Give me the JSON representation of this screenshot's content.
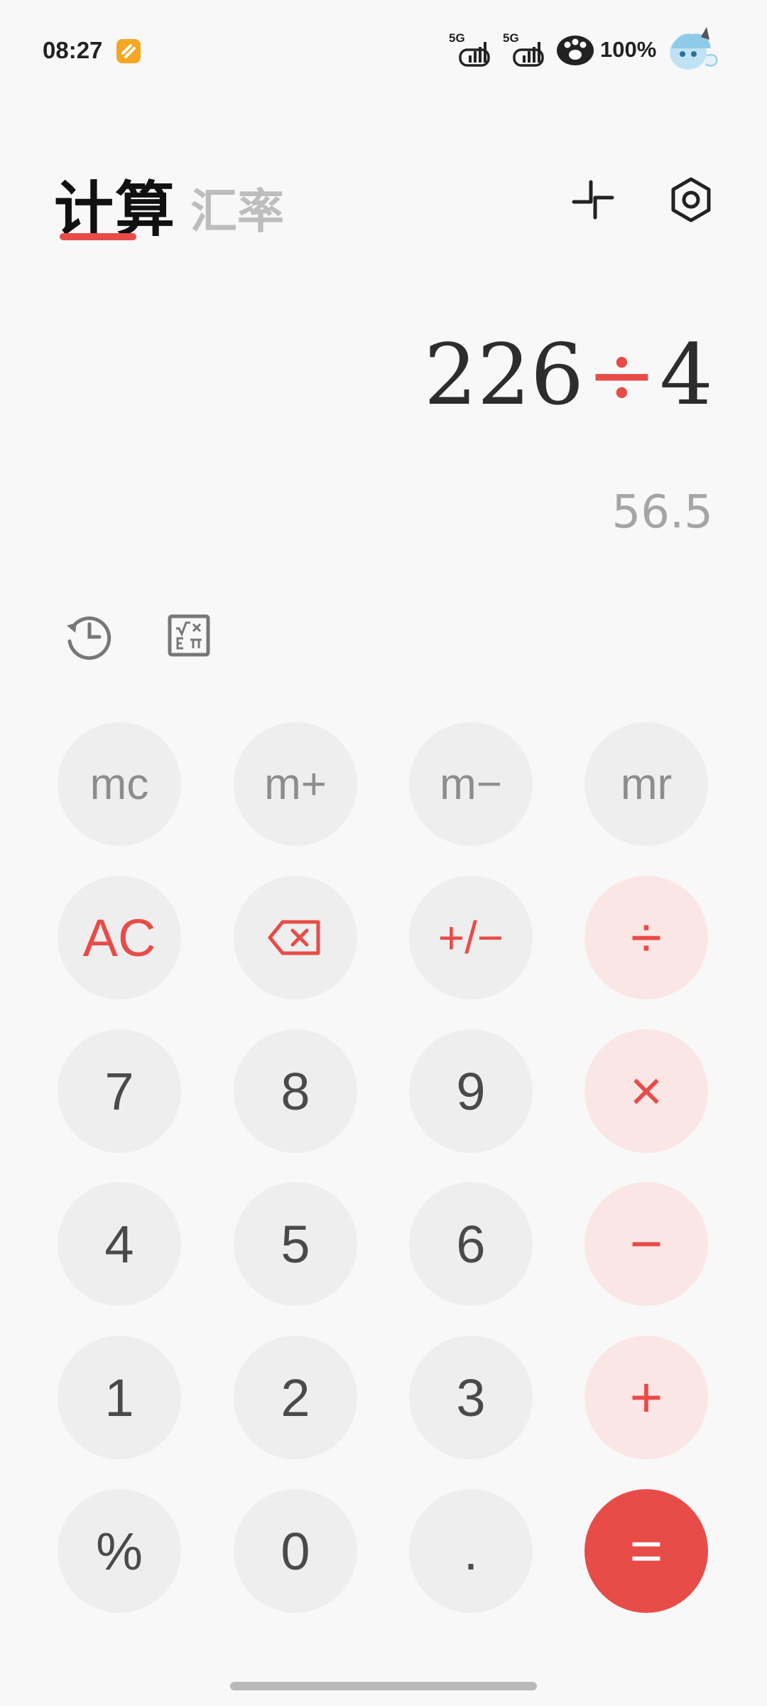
{
  "status_bar": {
    "time": "08:27",
    "sim1_label": "5G",
    "sim2_label": "5G",
    "battery": "100%",
    "icons": [
      "notification-app-icon",
      "signal-icon",
      "signal-icon",
      "paw-icon",
      "avatar-sticker"
    ]
  },
  "header": {
    "tab_calc": "计算",
    "tab_rate": "汇率",
    "active_tab": "计算",
    "icons": [
      "collapse-icon",
      "settings-icon"
    ]
  },
  "display": {
    "operand1": "226",
    "operator": "÷",
    "operand2": "4",
    "result": "56.5"
  },
  "tools": [
    "history-icon",
    "scientific-icon"
  ],
  "keys": {
    "mc": "mc",
    "mplus": "m+",
    "mminus": "m−",
    "mr": "mr",
    "ac": "AC",
    "sign": "+/−",
    "divide": "÷",
    "seven": "7",
    "eight": "8",
    "nine": "9",
    "multiply": "×",
    "four": "4",
    "five": "5",
    "six": "6",
    "minus": "−",
    "one": "1",
    "two": "2",
    "three": "3",
    "plus": "+",
    "percent": "%",
    "zero": "0",
    "dot": ".",
    "equals": "="
  },
  "colors": {
    "accent": "#e84c48",
    "key_bg": "#eeeeee",
    "op_key_bg": "#fbe6e6",
    "background": "#f8f8f8"
  }
}
